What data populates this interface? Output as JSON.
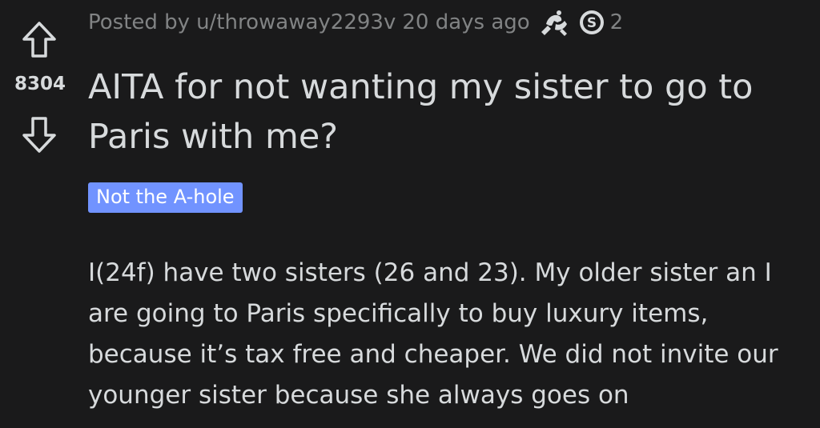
{
  "post": {
    "score": "8304",
    "meta": {
      "posted_by": "Posted by",
      "username": "u/throwaway2293v",
      "time": "20 days ago",
      "awards": [
        {
          "icon": "wholesome-award-icon",
          "count": ""
        },
        {
          "icon": "silver-award-icon",
          "count": "2"
        }
      ]
    },
    "title": "AITA for not wanting my sister to go to Paris with me?",
    "flair": "Not the A-hole",
    "flair_color": "#7193ff",
    "body": "I(24f) have two sisters (26 and 23). My older sister an I are going to Paris specifically to buy luxury items, because it’s tax free and cheaper. We did not invite our younger sister because she always goes on"
  },
  "colors": {
    "background": "#1a1a1b",
    "text": "#d7dadc",
    "muted": "#818384"
  }
}
